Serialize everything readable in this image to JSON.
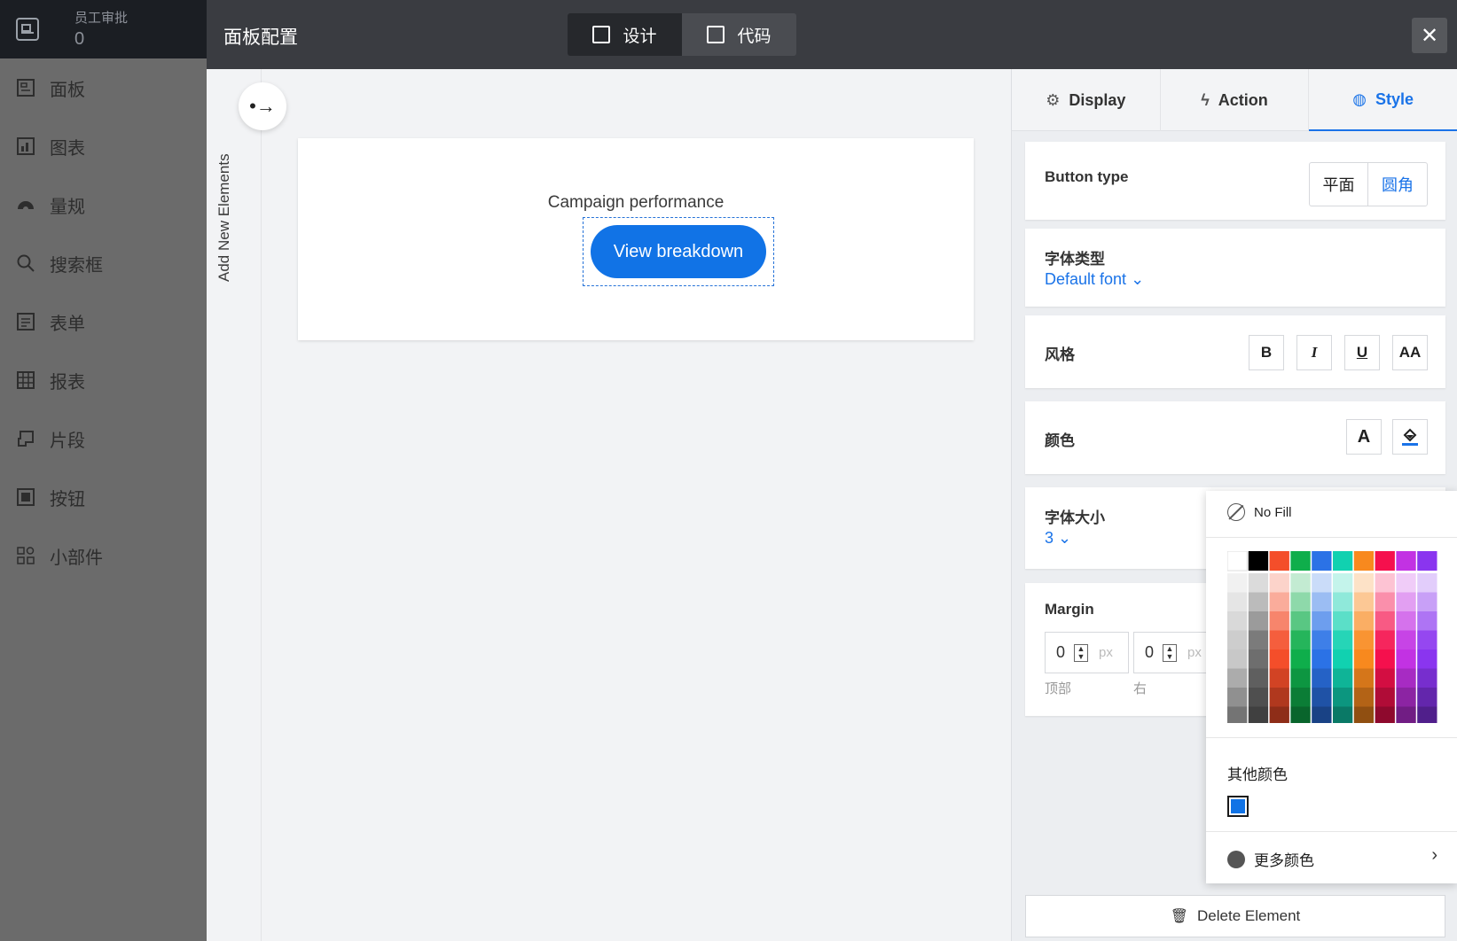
{
  "sidebar": {
    "top_title": "员工审批",
    "top_count": "0",
    "items": [
      {
        "label": "面板",
        "icon": "panel-icon"
      },
      {
        "label": "图表",
        "icon": "chart-icon"
      },
      {
        "label": "量规",
        "icon": "gauge-icon"
      },
      {
        "label": "搜索框",
        "icon": "search-icon"
      },
      {
        "label": "表单",
        "icon": "form-icon"
      },
      {
        "label": "报表",
        "icon": "table-icon"
      },
      {
        "label": "片段",
        "icon": "snippet-icon"
      },
      {
        "label": "按钮",
        "icon": "button-icon"
      },
      {
        "label": "小部件",
        "icon": "widget-icon"
      }
    ]
  },
  "header": {
    "title": "面板配置",
    "tab_design": "设计",
    "tab_code": "代码",
    "close_symbol": "✕"
  },
  "canvas": {
    "add_label": "Add New Elements",
    "add_symbol": "•→",
    "caption": "Campaign performance",
    "button_label": "View breakdown"
  },
  "panel": {
    "tabs": [
      {
        "label": "Display",
        "icon": "gear-icon",
        "glyph": "⚙"
      },
      {
        "label": "Action",
        "icon": "lightning-icon",
        "glyph": "ϟ"
      },
      {
        "label": "Style",
        "icon": "palette-icon",
        "glyph": "◍"
      }
    ],
    "button_type": {
      "label": "Button type",
      "opt1": "平面",
      "opt2": "圆角"
    },
    "font_type": {
      "label": "字体类型",
      "value": "Default font"
    },
    "style": {
      "label": "风格",
      "bold": "B",
      "italic": "I",
      "underline": "U",
      "caps": "AA"
    },
    "color": {
      "label": "颜色",
      "text_color": "A"
    },
    "font_size": {
      "label": "字体大小",
      "value": "3"
    },
    "margin": {
      "label": "Margin",
      "top_value": "0",
      "right_value": "0",
      "unit": "px",
      "top_caption": "顶部",
      "right_caption": "右"
    },
    "delete_label": "Delete Element"
  },
  "color_popup": {
    "no_fill": "No Fill",
    "other_colors": "其他颜色",
    "more_colors": "更多颜色",
    "current_color": "#1173e6",
    "base_colors": [
      "#ffffff",
      "#000000",
      "#f44e2a",
      "#0fae4b",
      "#2b72e6",
      "#11d1b0",
      "#f8891e",
      "#f5104d",
      "#c232e3",
      "#8a35ef"
    ]
  }
}
